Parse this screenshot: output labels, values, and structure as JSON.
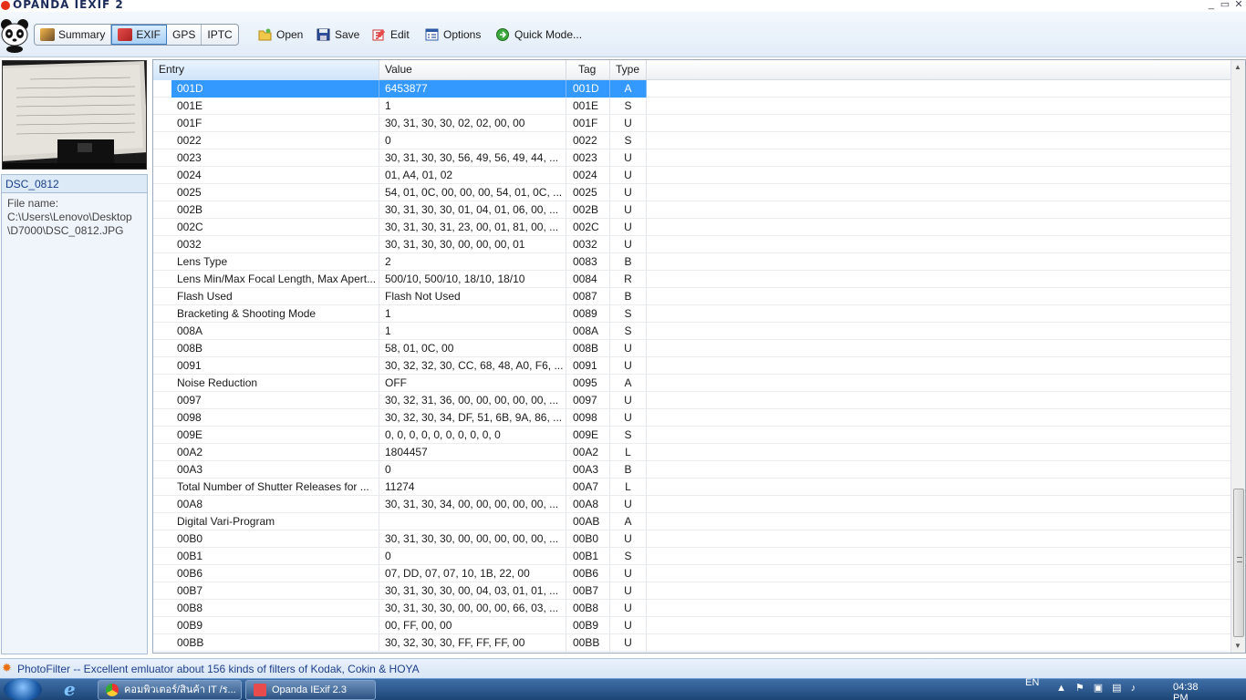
{
  "window": {
    "title": "OPANDA IEXIF 2",
    "controls": [
      "_",
      "▭",
      "✕"
    ]
  },
  "toolbar": {
    "tabs": [
      {
        "label": "Summary",
        "icon": "summary-icon",
        "active": false
      },
      {
        "label": "EXIF",
        "icon": "exif-icon",
        "active": true
      },
      {
        "label": "GPS",
        "icon": "",
        "active": false
      },
      {
        "label": "IPTC",
        "icon": "",
        "active": false
      }
    ],
    "actions": [
      {
        "label": "Open",
        "icon": "open-folder-icon"
      },
      {
        "label": "Save",
        "icon": "save-disk-icon"
      },
      {
        "label": "Edit",
        "icon": "edit-icon"
      },
      {
        "label": "Options",
        "icon": "options-icon"
      },
      {
        "label": "Quick Mode...",
        "icon": "quick-mode-icon"
      }
    ]
  },
  "file": {
    "name": "DSC_0812",
    "path_label": "File name:",
    "path_lines": [
      "C:\\Users\\Lenovo\\Desktop",
      "\\D7000\\DSC_0812.JPG"
    ]
  },
  "table": {
    "headers": {
      "entry": "Entry",
      "value": "Value",
      "tag": "Tag",
      "type": "Type"
    },
    "selected_index": 0,
    "rows": [
      {
        "entry": "001D",
        "value": "6453877",
        "tag": "001D",
        "type": "A"
      },
      {
        "entry": "001E",
        "value": "1",
        "tag": "001E",
        "type": "S"
      },
      {
        "entry": "001F",
        "value": "30, 31, 30, 30, 02, 02, 00, 00",
        "tag": "001F",
        "type": "U"
      },
      {
        "entry": "0022",
        "value": "0",
        "tag": "0022",
        "type": "S"
      },
      {
        "entry": "0023",
        "value": "30, 31, 30, 30, 56, 49, 56, 49, 44, ...",
        "tag": "0023",
        "type": "U"
      },
      {
        "entry": "0024",
        "value": "01, A4, 01, 02",
        "tag": "0024",
        "type": "U"
      },
      {
        "entry": "0025",
        "value": "54, 01, 0C, 00, 00, 00, 54, 01, 0C, ...",
        "tag": "0025",
        "type": "U"
      },
      {
        "entry": "002B",
        "value": "30, 31, 30, 30, 01, 04, 01, 06, 00, ...",
        "tag": "002B",
        "type": "U"
      },
      {
        "entry": "002C",
        "value": "30, 31, 30, 31, 23, 00, 01, 81, 00, ...",
        "tag": "002C",
        "type": "U"
      },
      {
        "entry": "0032",
        "value": "30, 31, 30, 30, 00, 00, 00, 01",
        "tag": "0032",
        "type": "U"
      },
      {
        "entry": "Lens Type",
        "value": "2",
        "tag": "0083",
        "type": "B"
      },
      {
        "entry": "Lens Min/Max Focal Length, Max Apert...",
        "value": "500/10, 500/10, 18/10, 18/10",
        "tag": "0084",
        "type": "R"
      },
      {
        "entry": "Flash Used",
        "value": "Flash Not Used",
        "tag": "0087",
        "type": "B"
      },
      {
        "entry": "Bracketing & Shooting Mode",
        "value": "1",
        "tag": "0089",
        "type": "S"
      },
      {
        "entry": "008A",
        "value": "1",
        "tag": "008A",
        "type": "S"
      },
      {
        "entry": "008B",
        "value": "58, 01, 0C, 00",
        "tag": "008B",
        "type": "U"
      },
      {
        "entry": "0091",
        "value": "30, 32, 32, 30, CC, 68, 48, A0, F6, ...",
        "tag": "0091",
        "type": "U"
      },
      {
        "entry": "Noise Reduction",
        "value": "OFF",
        "tag": "0095",
        "type": "A"
      },
      {
        "entry": "0097",
        "value": "30, 32, 31, 36, 00, 00, 00, 00, 00, ...",
        "tag": "0097",
        "type": "U"
      },
      {
        "entry": "0098",
        "value": "30, 32, 30, 34, DF, 51, 6B, 9A, 86, ...",
        "tag": "0098",
        "type": "U"
      },
      {
        "entry": "009E",
        "value": "0, 0, 0, 0, 0, 0, 0, 0, 0, 0",
        "tag": "009E",
        "type": "S"
      },
      {
        "entry": "00A2",
        "value": "1804457",
        "tag": "00A2",
        "type": "L"
      },
      {
        "entry": "00A3",
        "value": "0",
        "tag": "00A3",
        "type": "B"
      },
      {
        "entry": "Total Number of Shutter Releases for ...",
        "value": "11274",
        "tag": "00A7",
        "type": "L"
      },
      {
        "entry": "00A8",
        "value": "30, 31, 30, 34, 00, 00, 00, 00, 00, ...",
        "tag": "00A8",
        "type": "U"
      },
      {
        "entry": "Digital Vari-Program",
        "value": "",
        "tag": "00AB",
        "type": "A"
      },
      {
        "entry": "00B0",
        "value": "30, 31, 30, 30, 00, 00, 00, 00, 00, ...",
        "tag": "00B0",
        "type": "U"
      },
      {
        "entry": "00B1",
        "value": "0",
        "tag": "00B1",
        "type": "S"
      },
      {
        "entry": "00B6",
        "value": "07, DD, 07, 07, 10, 1B, 22, 00",
        "tag": "00B6",
        "type": "U"
      },
      {
        "entry": "00B7",
        "value": "30, 31, 30, 30, 00, 04, 03, 01, 01, ...",
        "tag": "00B7",
        "type": "U"
      },
      {
        "entry": "00B8",
        "value": "30, 31, 30, 30, 00, 00, 00, 66, 03, ...",
        "tag": "00B8",
        "type": "U"
      },
      {
        "entry": "00B9",
        "value": "00, FF, 00, 00",
        "tag": "00B9",
        "type": "U"
      },
      {
        "entry": "00BB",
        "value": "30, 32, 30, 30, FF, FF, FF, 00",
        "tag": "00BB",
        "type": "U"
      }
    ]
  },
  "status": {
    "text": "PhotoFilter -- Excellent emluator about 156 kinds of filters of Kodak, Cokin & HOYA",
    "icon": "sun-icon"
  },
  "taskbar": {
    "tasks": [
      {
        "label": "คอมพิวเตอร์/สินค้า IT /ร...",
        "icon": "chrome-icon"
      },
      {
        "label": "Opanda IExif 2.3",
        "icon": "opanda-icon"
      }
    ],
    "language": "EN",
    "clock": "04:38 PM"
  },
  "colors": {
    "selection": "#3399ff",
    "accent": "#1a3f8a"
  }
}
